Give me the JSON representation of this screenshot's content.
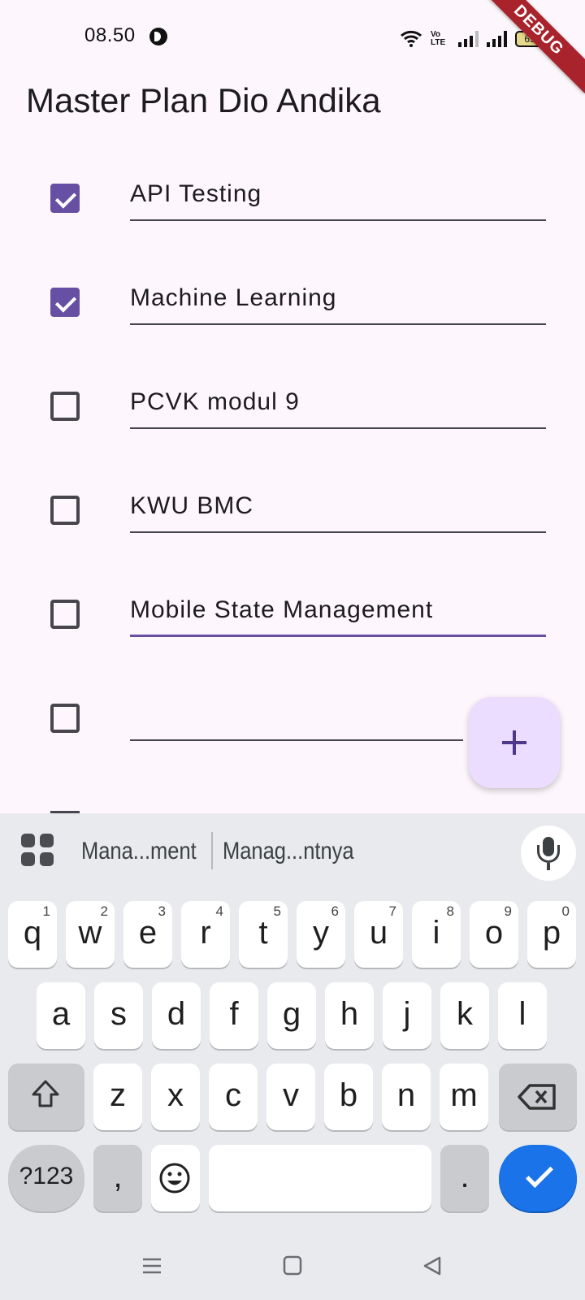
{
  "status_bar": {
    "time": "08.50",
    "volte": "Vo LTE",
    "battery": "69",
    "icons": [
      "notification-icon",
      "wifi-icon",
      "volte-icon",
      "signal-icon",
      "signal-icon",
      "battery-icon"
    ]
  },
  "debug_banner": "DEBUG",
  "app": {
    "title": "Master Plan Dio Andika",
    "tasks": [
      {
        "text": "API Testing",
        "checked": true
      },
      {
        "text": "Machine Learning",
        "checked": true
      },
      {
        "text": "PCVK modul 9",
        "checked": false
      },
      {
        "text": "KWU BMC",
        "checked": false
      },
      {
        "text": "Mobile State Management",
        "checked": false,
        "focused": true
      },
      {
        "text": "",
        "checked": false
      }
    ],
    "fab_icon": "add-icon"
  },
  "keyboard": {
    "suggestions": [
      "Mana...ment",
      "Manag...ntnya"
    ],
    "row1": [
      {
        "key": "q",
        "hint": "1"
      },
      {
        "key": "w",
        "hint": "2"
      },
      {
        "key": "e",
        "hint": "3"
      },
      {
        "key": "r",
        "hint": "4"
      },
      {
        "key": "t",
        "hint": "5"
      },
      {
        "key": "y",
        "hint": "6"
      },
      {
        "key": "u",
        "hint": "7"
      },
      {
        "key": "i",
        "hint": "8"
      },
      {
        "key": "o",
        "hint": "9"
      },
      {
        "key": "p",
        "hint": "0"
      }
    ],
    "row2": [
      "a",
      "s",
      "d",
      "f",
      "g",
      "h",
      "j",
      "k",
      "l"
    ],
    "row3": [
      "z",
      "x",
      "c",
      "v",
      "b",
      "n",
      "m"
    ],
    "symbols_label": "?123",
    "comma": ",",
    "period": ".",
    "icons": [
      "apps-grid-icon",
      "mic-icon",
      "shift-icon",
      "backspace-icon",
      "emoji-icon",
      "enter-check-icon"
    ]
  },
  "nav_bar": {
    "icons": [
      "menu-icon",
      "home-icon",
      "back-icon"
    ]
  },
  "colors": {
    "background": "#fdf7fd",
    "primary": "#6750a4",
    "fab": "#eaddff",
    "keyboard_bg": "#e8eaed",
    "enter_key": "#1a73e8",
    "debug_ribbon": "#a8232b"
  }
}
